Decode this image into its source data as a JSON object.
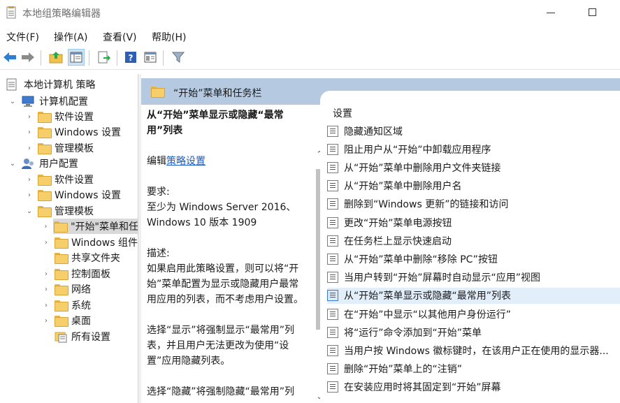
{
  "window": {
    "title": "本地组策略编辑器"
  },
  "menu": [
    "文件(F)",
    "操作(A)",
    "查看(V)",
    "帮助(H)"
  ],
  "toolbar": {
    "icons": [
      "back-arrow-icon",
      "forward-arrow-icon",
      "up-folder-icon",
      "show-hide-tree-icon",
      "export-icon",
      "help-icon",
      "properties-icon",
      "filter-icon"
    ]
  },
  "tree": {
    "root": "本地计算机 策略",
    "items": [
      {
        "label": "计算机配置",
        "level": 1,
        "expanded": true,
        "icon": "computer-icon"
      },
      {
        "label": "软件设置",
        "level": 2
      },
      {
        "label": "Windows 设置",
        "level": 2
      },
      {
        "label": "管理模板",
        "level": 2
      },
      {
        "label": "用户配置",
        "level": 1,
        "expanded": true,
        "icon": "user-icon"
      },
      {
        "label": "软件设置",
        "level": 2
      },
      {
        "label": "Windows 设置",
        "level": 2
      },
      {
        "label": "管理模板",
        "level": 2,
        "expanded": true
      },
      {
        "label": "\"开始\"菜单和任",
        "level": 3,
        "selected": true
      },
      {
        "label": "Windows 组件",
        "level": 3
      },
      {
        "label": "共享文件夹",
        "level": 3
      },
      {
        "label": "控制面板",
        "level": 3
      },
      {
        "label": "网络",
        "level": 3
      },
      {
        "label": "系统",
        "level": 3
      },
      {
        "label": "桌面",
        "level": 3
      },
      {
        "label": "所有设置",
        "level": 3
      }
    ]
  },
  "right": {
    "header": "“开始”菜单和任务栏",
    "description": {
      "title": "从“开始”菜单显示或隐藏“最常用”列表",
      "edit_prefix": "编辑",
      "edit_link": "策略设置",
      "requirements_label": "要求:",
      "requirements": "至少为 Windows Server 2016、Windows 10 版本 1909",
      "description_label": "描述:",
      "description": "如果启用此策略设置，则可以将“开始”菜单配置为显示或隐藏用户最常用应用的列表，而不考虑用户设置。",
      "para2": "选择“显示”将强制显示“最常用”列表，并且用户无法更改为使用“设置”应用隐藏列表。",
      "para3": "选择“隐藏”将强制隐藏“最常用”列"
    },
    "settings_header": "设置",
    "settings": [
      "隐藏通知区域",
      "阻止用户从“开始”中卸载应用程序",
      "从“开始”菜单中删除用户文件夹链接",
      "从“开始”菜单中删除用户名",
      "删除到“Windows 更新”的链接和访问",
      "更改“开始”菜单电源按钮",
      "在任务栏上显示快速启动",
      "从“开始”菜单中删除“移除 PC”按钮",
      "当用户转到“开始”屏幕时自动显示“应用”视图",
      "从“开始”菜单显示或隐藏“最常用”列表",
      "在“开始”中显示“以其他用户身份运行”",
      "将“运行”命令添加到“开始”菜单",
      "当用户按 Windows 徽标键时，在该用户正在使用的显示器...",
      "删除“开始”菜单上的“注销”",
      "在安装应用时将其固定到“开始”屏幕"
    ],
    "selected_setting_index": 9
  },
  "colors": {
    "header_bg": "#b5c9e0",
    "selection": "#e3eefb",
    "link": "#1a5cc8"
  }
}
